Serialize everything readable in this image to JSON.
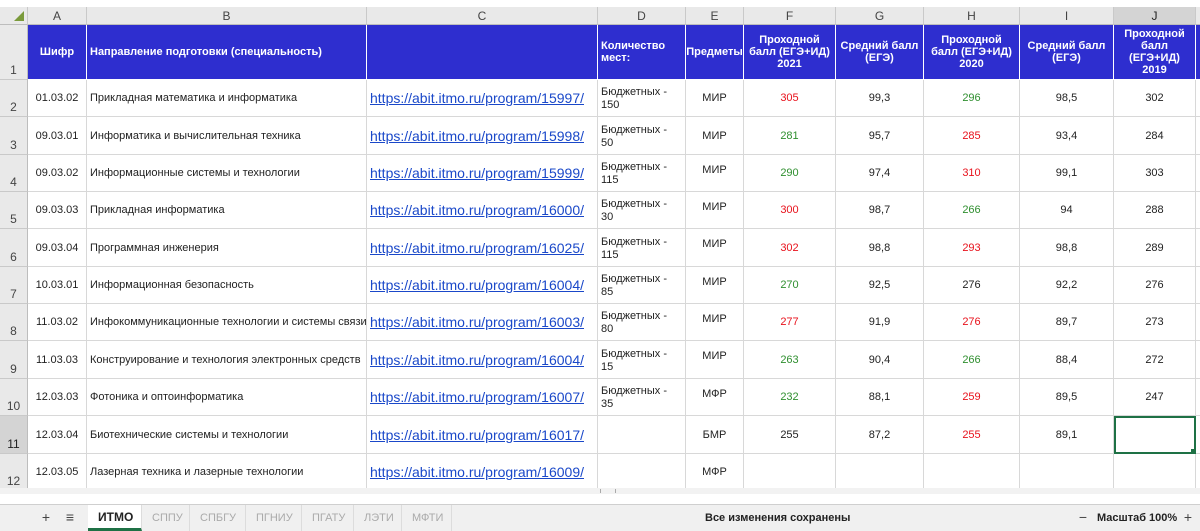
{
  "columns": [
    "A",
    "B",
    "C",
    "D",
    "E",
    "F",
    "G",
    "H",
    "I",
    "J"
  ],
  "row_numbers": [
    "1",
    "2",
    "3",
    "4",
    "5",
    "6",
    "7",
    "8",
    "9",
    "10",
    "11",
    "12"
  ],
  "headers": {
    "code": "Шифр",
    "direction": "Направление подготовки (специальность)",
    "link": "",
    "places": "Количество мест:",
    "subjects": "Предметы",
    "pass2021": "Проходной балл (ЕГЭ+ИД) 2021",
    "avg2021": "Средний балл (ЕГЭ)",
    "pass2020": "Проходной балл (ЕГЭ+ИД) 2020",
    "avg2020": "Средний балл (ЕГЭ)",
    "pass2019": "Проходной балл (ЕГЭ+ИД) 2019"
  },
  "rows": [
    {
      "code": "01.03.02",
      "direction": "Прикладная математика и информатика",
      "link": "https://abit.itmo.ru/program/15997/",
      "places": "Бюджетных - 150",
      "subjects": "МИР",
      "pass2021": "305",
      "avg2021": "99,3",
      "pass2020": "296",
      "avg2020": "98,5",
      "pass2019": "302"
    },
    {
      "code": "09.03.01",
      "direction": "Информатика и вычислительная техника",
      "link": "https://abit.itmo.ru/program/15998/",
      "places": "Бюджетных - 50",
      "subjects": "МИР",
      "pass2021": "281",
      "avg2021": "95,7",
      "pass2020": "285",
      "avg2020": "93,4",
      "pass2019": "284"
    },
    {
      "code": "09.03.02",
      "direction": "Информационные системы и технологии",
      "link": "https://abit.itmo.ru/program/15999/",
      "places": "Бюджетных - 115",
      "subjects": "МИР",
      "pass2021": "290",
      "avg2021": "97,4",
      "pass2020": "310",
      "avg2020": "99,1",
      "pass2019": "303"
    },
    {
      "code": "09.03.03",
      "direction": "Прикладная информатика",
      "link": "https://abit.itmo.ru/program/16000/",
      "places": "Бюджетных - 30",
      "subjects": "МИР",
      "pass2021": "300",
      "avg2021": "98,7",
      "pass2020": "266",
      "avg2020": "94",
      "pass2019": "288"
    },
    {
      "code": "09.03.04",
      "direction": "Программная инженерия",
      "link": "https://abit.itmo.ru/program/16025/",
      "places": "Бюджетных - 115",
      "subjects": "МИР",
      "pass2021": "302",
      "avg2021": "98,8",
      "pass2020": "293",
      "avg2020": "98,8",
      "pass2019": "289"
    },
    {
      "code": "10.03.01",
      "direction": "Информационная безопасность",
      "link": "https://abit.itmo.ru/program/16004/",
      "places": "Бюджетных - 85",
      "subjects": "МИР",
      "pass2021": "270",
      "avg2021": "92,5",
      "pass2020": "276",
      "avg2020": "92,2",
      "pass2019": "276"
    },
    {
      "code": "11.03.02",
      "direction": "Инфокоммуникационные технологии и системы связи",
      "link": "https://abit.itmo.ru/program/16003/",
      "places": "Бюджетных - 80",
      "subjects": "МИР",
      "pass2021": "277",
      "avg2021": "91,9",
      "pass2020": "276",
      "avg2020": "89,7",
      "pass2019": "273"
    },
    {
      "code": "11.03.03",
      "direction": "Конструирование и технология электронных средств",
      "link": "https://abit.itmo.ru/program/16004/",
      "places": "Бюджетных - 15",
      "subjects": "МИР",
      "pass2021": "263",
      "avg2021": "90,4",
      "pass2020": "266",
      "avg2020": "88,4",
      "pass2019": "272"
    },
    {
      "code": "12.03.03",
      "direction": "Фотоника и оптоинформатика",
      "link": "https://abit.itmo.ru/program/16007/",
      "places": "Бюджетных - 35",
      "subjects": "МФР",
      "pass2021": "232",
      "avg2021": "88,1",
      "pass2020": "259",
      "avg2020": "89,5",
      "pass2019": "247"
    },
    {
      "code": "12.03.04",
      "direction": "Биотехнические системы и технологии",
      "link": "https://abit.itmo.ru/program/16017/",
      "places": "",
      "subjects": "БМР",
      "pass2021": "255",
      "avg2021": "87,2",
      "pass2020": "255",
      "avg2020": "89,1",
      "pass2019": ""
    },
    {
      "code": "12.03.05",
      "direction": "Лазерная техника и лазерные технологии",
      "link": "https://abit.itmo.ru/program/16009/",
      "places": "",
      "subjects": "МФР",
      "pass2021": "",
      "avg2021": "",
      "pass2020": "",
      "avg2020": "",
      "pass2019": ""
    }
  ],
  "colors": {
    "pass2021": [
      "red",
      "green",
      "green",
      "red",
      "red",
      "green",
      "red",
      "green",
      "green",
      "black",
      "black"
    ],
    "pass2020": [
      "green",
      "red",
      "red",
      "green",
      "red",
      "black",
      "red",
      "green",
      "red",
      "red",
      "black"
    ],
    "header_bg": "#2e2ecf",
    "link": "#1a48c9",
    "accent": "#1e7145"
  },
  "sheet_tabs": [
    "ИТМО",
    "СППУ",
    "СПБГУ",
    "ПГНИУ",
    "ПГАТУ",
    "ЛЭТИ",
    "МФТИ"
  ],
  "active_tab": "ИТМО",
  "status_text": "Все изменения сохранены",
  "zoom_label": "Масштаб 100%",
  "icons": {
    "add_sheet": "plus-icon",
    "sheet_list": "menu-icon",
    "zoom_out": "minus-icon",
    "zoom_in": "plus-icon"
  }
}
